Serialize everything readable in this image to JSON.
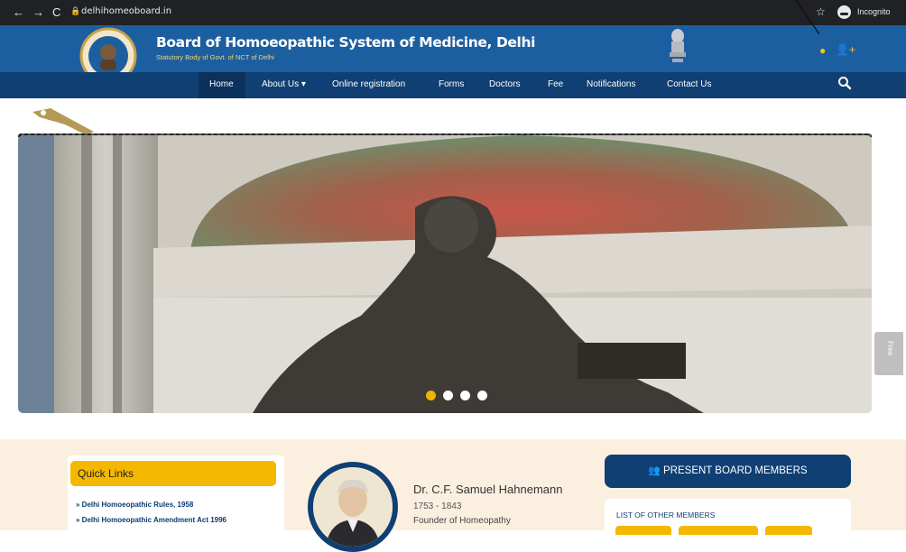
{
  "browser": {
    "url": "delhihomeoboard.in",
    "incognito_label": "Incognito"
  },
  "header": {
    "title": "Board of Homoeopathic System of Medicine, Delhi",
    "subtitle": "Statutory Body of Govt. of NCT of Delhi",
    "user_icon": "user-circle-icon",
    "register_icon": "user-plus-icon"
  },
  "nav": {
    "items": [
      "Home",
      "About Us ▾",
      "Online registration",
      "Forms",
      "Doctors",
      "Fee",
      "Notifications",
      "Contact Us"
    ],
    "search_icon": "search-icon"
  },
  "slider": {
    "dot_count": 4,
    "active_index": 0,
    "side_tab_label": "Free"
  },
  "quick_links": {
    "title": "Quick Links",
    "links": [
      "» Delhi Homoeopathic Rules, 1958",
      "» Delhi Homoeopathic Amendment Act 1996"
    ]
  },
  "founder": {
    "name": "Dr. C.F. Samuel Hahnemann",
    "years": "1753 - 1843",
    "role": "Founder of Homeopathy"
  },
  "members": {
    "button_label": "PRESENT BOARD MEMBERS",
    "other_title": "LIST OF OTHER MEMBERS"
  },
  "colors": {
    "header_blue": "#1c5fa0",
    "nav_blue": "#103f73",
    "accent_yellow": "#f5b800",
    "band_cream": "#fbefe0"
  }
}
